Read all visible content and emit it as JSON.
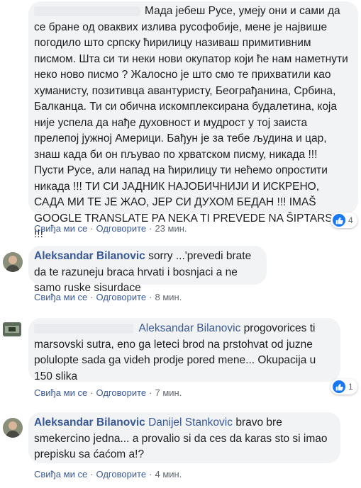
{
  "comments": [
    {
      "author": "",
      "text": "Мада јебеш Русе, умеју они и сами да се бране од оваквих излива русофобије, мене је највише погодило што српску ћирилицу називаш примитивним писмом. Шта си ти неки нови окупатор који ће нам наметнути неко ново писмо ? Жалосно је што смо те прихватили као хуманисту, позитивца авантуристу, Београђанина, Србина, Балканца. Ти си обична искомплексирана будалетина, која није успела да нађе духовност и мудрост у тој заиста прелепој јужној Америци. Бађун је за тебе људина и цар, знаш када би он пљувао по хрватском писму, никада !!! Пусти Русе, али напад на ћирилицу ти нећемо опростити никада !!! ТИ СИ ЈАДНИК НАЈОБИЧНИЈИ И ИСКРЕНО, САДА МИ ТЕ ЈЕ ЖАО, ЈЕР СИ ДУХОМ БЕДАН !!! IMAŠ GOOGLE TRANSLATE PA NEKA TI PREVEDE NA ŠIPTARSKI !!!",
      "like": "Свиђа ми се",
      "reply": "Одговорите",
      "time": "23 мин.",
      "reactions": "4"
    },
    {
      "author": "Aleksandar Bilanovic",
      "text": "sorry ...'prevedi brate da te razuneju braca hrvati i bosnjaci a ne samo ruske sisurdace",
      "like": "Свиђа ми се",
      "reply": "Одговорите",
      "time": "8 мин."
    },
    {
      "author": "",
      "mention": "Aleksandar Bilanovic",
      "text": "progovorices ti marsovski sutra, eno ga leteci brod na prstohvat od juzne polulopte sada ga videh prodje pored mene... Okupacija u 150 slika",
      "like": "Свиђа ми се",
      "reply": "Одговорите",
      "time": "7 мин.",
      "reactions": "1"
    },
    {
      "author": "Aleksandar Bilanovic",
      "mention": "Danijel Stankovic",
      "text": "bravo bre smekercino jedna... a provalio si da ces da karas sto si imao prepisku sa ćaćom a!?",
      "like": "Свиђа ми се",
      "reply": "Одговорите",
      "time": "4 мин."
    }
  ],
  "icons": {
    "like": "thumbs-up-icon"
  },
  "colors": {
    "link": "#385898",
    "bubble": "#f2f3f5",
    "like_blue": "#1877f2"
  }
}
